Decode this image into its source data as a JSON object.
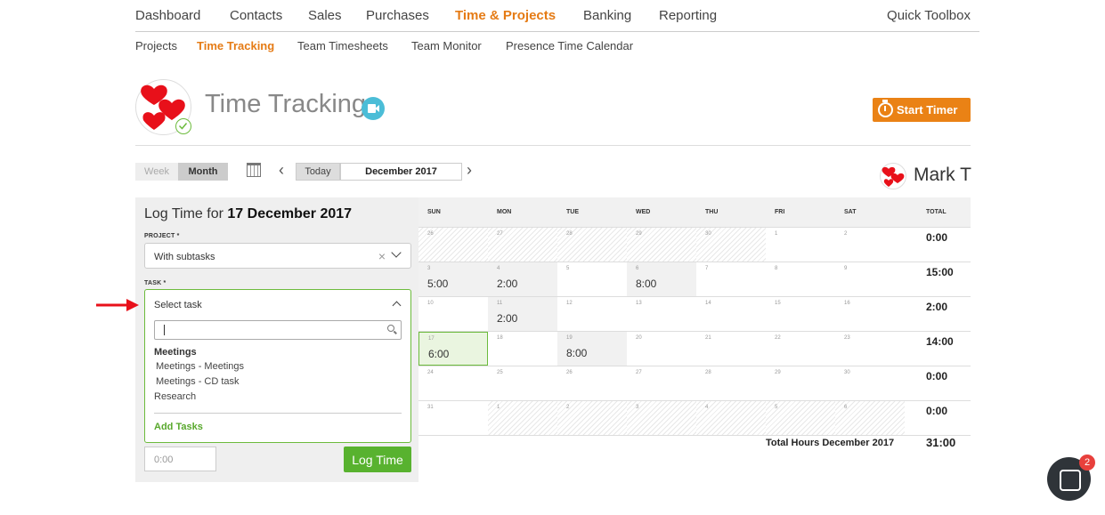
{
  "top_nav": {
    "items": [
      "Dashboard",
      "Contacts",
      "Sales",
      "Purchases",
      "Time & Projects",
      "Banking",
      "Reporting"
    ],
    "active": "Time & Projects",
    "toolbox": "Quick Toolbox"
  },
  "sub_nav": {
    "items": [
      "Projects",
      "Time Tracking",
      "Team Timesheets",
      "Team Monitor",
      "Presence Time Calendar"
    ],
    "active": "Time Tracking"
  },
  "header": {
    "title": "Time Tracking",
    "start_timer": "Start Timer"
  },
  "controls": {
    "week": "Week",
    "month": "Month",
    "today": "Today",
    "period": "December 2017"
  },
  "user": {
    "name": "Mark T"
  },
  "log_form": {
    "title_prefix": "Log Time for",
    "title_date": "17 December 2017",
    "project_label": "PROJECT *",
    "project_value": "With subtasks",
    "task_label": "TASK *",
    "task_placeholder": "Select task",
    "task_groups": [
      {
        "group": "Meetings",
        "options": [
          "Meetings - Meetings",
          "Meetings - CD task"
        ]
      }
    ],
    "task_flat_options": [
      "Research"
    ],
    "add_tasks": "Add Tasks",
    "time_placeholder": "0:00",
    "log_button": "Log Time"
  },
  "calendar": {
    "headers": [
      "SUN",
      "MON",
      "TUE",
      "WED",
      "THU",
      "FRI",
      "SAT",
      "TOTAL"
    ],
    "weeks": [
      {
        "days": [
          {
            "d": "26",
            "h": "",
            "s": "hatch"
          },
          {
            "d": "27",
            "h": "",
            "s": "hatch"
          },
          {
            "d": "28",
            "h": "",
            "s": "hatch"
          },
          {
            "d": "29",
            "h": "",
            "s": "hatch"
          },
          {
            "d": "30",
            "h": "",
            "s": "hatch"
          },
          {
            "d": "1",
            "h": "",
            "s": ""
          },
          {
            "d": "2",
            "h": "",
            "s": ""
          }
        ],
        "total": "0:00"
      },
      {
        "days": [
          {
            "d": "3",
            "h": "5:00",
            "s": "shade"
          },
          {
            "d": "4",
            "h": "2:00",
            "s": "shade"
          },
          {
            "d": "5",
            "h": "",
            "s": ""
          },
          {
            "d": "6",
            "h": "8:00",
            "s": "shade"
          },
          {
            "d": "7",
            "h": "",
            "s": ""
          },
          {
            "d": "8",
            "h": "",
            "s": ""
          },
          {
            "d": "9",
            "h": "",
            "s": ""
          }
        ],
        "total": "15:00"
      },
      {
        "days": [
          {
            "d": "10",
            "h": "",
            "s": ""
          },
          {
            "d": "11",
            "h": "2:00",
            "s": "shade"
          },
          {
            "d": "12",
            "h": "",
            "s": ""
          },
          {
            "d": "13",
            "h": "",
            "s": ""
          },
          {
            "d": "14",
            "h": "",
            "s": ""
          },
          {
            "d": "15",
            "h": "",
            "s": ""
          },
          {
            "d": "16",
            "h": "",
            "s": ""
          }
        ],
        "total": "2:00"
      },
      {
        "days": [
          {
            "d": "17",
            "h": "6:00",
            "s": "today"
          },
          {
            "d": "18",
            "h": "",
            "s": ""
          },
          {
            "d": "19",
            "h": "8:00",
            "s": "shade"
          },
          {
            "d": "20",
            "h": "",
            "s": ""
          },
          {
            "d": "21",
            "h": "",
            "s": ""
          },
          {
            "d": "22",
            "h": "",
            "s": ""
          },
          {
            "d": "23",
            "h": "",
            "s": ""
          }
        ],
        "total": "14:00"
      },
      {
        "days": [
          {
            "d": "24",
            "h": "",
            "s": ""
          },
          {
            "d": "25",
            "h": "",
            "s": ""
          },
          {
            "d": "26",
            "h": "",
            "s": ""
          },
          {
            "d": "27",
            "h": "",
            "s": ""
          },
          {
            "d": "28",
            "h": "",
            "s": ""
          },
          {
            "d": "29",
            "h": "",
            "s": ""
          },
          {
            "d": "30",
            "h": "",
            "s": ""
          }
        ],
        "total": "0:00"
      },
      {
        "days": [
          {
            "d": "31",
            "h": "",
            "s": ""
          },
          {
            "d": "1",
            "h": "",
            "s": "hatch"
          },
          {
            "d": "2",
            "h": "",
            "s": "hatch"
          },
          {
            "d": "3",
            "h": "",
            "s": "hatch"
          },
          {
            "d": "4",
            "h": "",
            "s": "hatch"
          },
          {
            "d": "5",
            "h": "",
            "s": "hatch"
          },
          {
            "d": "6",
            "h": "",
            "s": "hatch"
          }
        ],
        "total": "0:00"
      }
    ],
    "footer_label": "Total Hours December 2017",
    "footer_total": "31:00"
  },
  "chat": {
    "badge": "2"
  },
  "colors": {
    "accent": "#e57b15",
    "green": "#58b22f",
    "logo_red": "#e8101a"
  }
}
